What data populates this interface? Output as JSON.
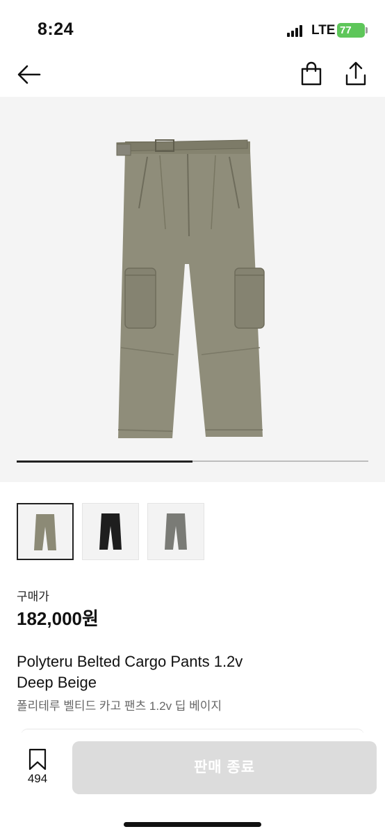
{
  "status_bar": {
    "time": "8:24",
    "network": "LTE",
    "battery": "77",
    "battery_color": "#5ec65a"
  },
  "nav": {
    "back_icon": "arrow-left-icon",
    "bag_icon": "shopping-bag-icon",
    "share_icon": "share-icon"
  },
  "gallery": {
    "image_progress": 0.5,
    "thumbnails": [
      {
        "color_name": "deep-beige",
        "color": "#8c8a76",
        "selected": true
      },
      {
        "color_name": "black",
        "color": "#1e1e1e",
        "selected": false
      },
      {
        "color_name": "grey",
        "color": "#7a7b76",
        "selected": false
      }
    ]
  },
  "product": {
    "price_label": "구매가",
    "price": "182,000원",
    "title_en_line1": "Polyteru Belted Cargo Pants 1.2v",
    "title_en_line2": "Deep Beige",
    "title_ko": "폴리테루 벨티드 카고 팬츠 1.2v 딥 베이지"
  },
  "bottom": {
    "bookmark_icon": "bookmark-icon",
    "bookmark_count": "494",
    "action_label": "판매 종료",
    "action_color": "#dcdcdc"
  }
}
